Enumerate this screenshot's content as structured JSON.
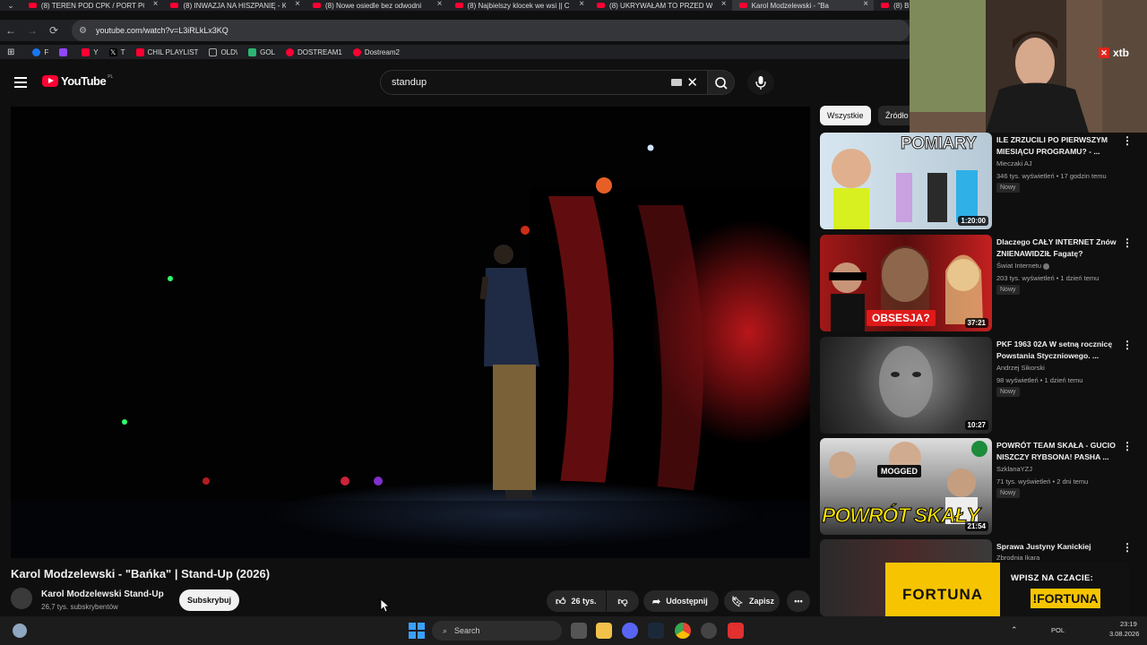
{
  "browser": {
    "tabs": [
      {
        "title": "(8) TEREN POD CPK / PORT PO"
      },
      {
        "title": "(8) INWAZJA NA HISZPANIĘ - K"
      },
      {
        "title": "(8) Nowe osiedle bez odwodni"
      },
      {
        "title": "(8) Najbielszy klocek we wsi || C"
      },
      {
        "title": "(8) UKRYWAŁAM TO PRZED W"
      },
      {
        "title": "Karol Modzelewski - \"Ba"
      },
      {
        "title": "(8) B"
      }
    ],
    "url": "youtube.com/watch?v=L3iRLkLx3KQ",
    "bookmarks": [
      {
        "label": "F",
        "color": "#1877f2"
      },
      {
        "label": "",
        "color": "#9146ff"
      },
      {
        "label": "Y",
        "color": "#ff0033"
      },
      {
        "label": "T",
        "color": "#000000"
      },
      {
        "label": "CHIL PLAYLIST",
        "color": "#ff0033"
      },
      {
        "label": "OLD\\",
        "color": "#888888"
      },
      {
        "label": "GOL",
        "color": "#2bb673"
      },
      {
        "label": "DOSTREAM1",
        "color": "#ff0033"
      },
      {
        "label": "Dostream2",
        "color": "#ff0033"
      }
    ]
  },
  "youtube": {
    "logo": "YouTube",
    "region": "PL",
    "search_value": "standup"
  },
  "video": {
    "title": "Karol Modzelewski - \"Bańka\" | Stand-Up (2026)",
    "channel": "Karol Modzelewski Stand-Up",
    "subscribers": "26,7 tys. subskrybentów",
    "subscribe_label": "Subskrybuj",
    "likes": "26 tys.",
    "share_label": "Udostępnij",
    "save_label": "Zapisz"
  },
  "sidebar": {
    "chips": [
      "Wszystkie",
      "Źródło"
    ],
    "recommendations": [
      {
        "title": "ILE ZRZUCILI PO PIERWSZYM MIESIĄCU PROGRAMU? - ...",
        "channel": "Mieczaki AJ",
        "meta": "346 tys. wyświetleń • 17 godzin temu",
        "badge": "Nowy",
        "duration": "1:20:00",
        "thumb_text": "POMIARY"
      },
      {
        "title": "Dlaczego CAŁY INTERNET Znów ZNIENAWIDZIŁ Fagatę?",
        "channel": "Świat Internetu",
        "meta": "203 tys. wyświetleń • 1 dzień temu",
        "badge": "Nowy",
        "duration": "37:21",
        "thumb_text": "OBSESJA?"
      },
      {
        "title": "PKF 1963 02A W setną rocznicę Powstania Styczniowego. ...",
        "channel": "Andrzej Sikorski",
        "meta": "98 wyświetleń • 1 dzień temu",
        "badge": "Nowy",
        "duration": "10:27",
        "thumb_text": ""
      },
      {
        "title": "POWRÓT TEAM SKAŁA - GUCIO NISZCZY RYBSONA! PASHA ...",
        "channel": "SzklanaYZJ",
        "meta": "71 tys. wyświetleń • 2 dni temu",
        "badge": "Nowy",
        "duration": "21:54",
        "thumb_text": "POWRÓT SKAŁY",
        "thumb_text2": "MOGGED"
      },
      {
        "title": "Sprawa Justyny Kanickiej",
        "channel": "Zbrodnia Ikara",
        "meta": "",
        "badge": "",
        "duration": "",
        "thumb_text": ""
      }
    ]
  },
  "overlay": {
    "brand": "xtb",
    "ad_left": "FORTUNA",
    "ad_right_line1": "WPISZ NA CZACIE:",
    "ad_right_line2": "!FORTUNA"
  },
  "taskbar": {
    "search_placeholder": "Search",
    "lang": "POL",
    "time": "23:19",
    "date": "3.08.2026"
  }
}
